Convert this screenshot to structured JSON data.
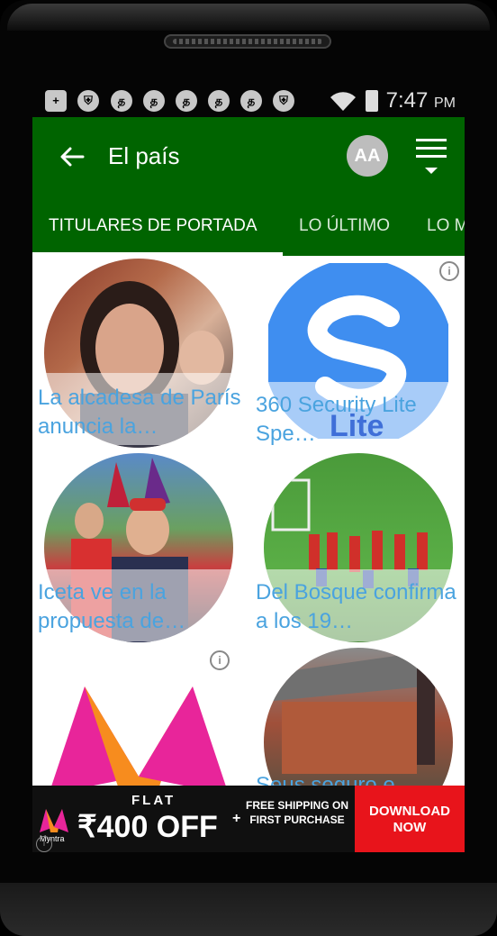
{
  "statusbar": {
    "icons": [
      "plus-box-icon",
      "shield-icon",
      "tamil-letter-icon",
      "tamil-letter-icon",
      "tamil-letter-icon",
      "tamil-letter-icon",
      "tamil-letter-icon",
      "shield-icon"
    ],
    "time": "7:47",
    "ampm": "PM"
  },
  "appbar": {
    "title": "El país",
    "font_button": "AA",
    "background": "#006400"
  },
  "tabs": [
    {
      "label": "TITULARES DE PORTADA",
      "active": true
    },
    {
      "label": "LO ÚLTIMO",
      "active": false
    },
    {
      "label": "LO M",
      "active": false
    }
  ],
  "cards": [
    {
      "caption": "La alcadesa de París anuncia la…",
      "type": "article"
    },
    {
      "caption": "360 Security Lite Spe…",
      "type": "ad",
      "logo_text": "Lite"
    },
    {
      "caption": "Iceta ve en la propuesta de…",
      "type": "article"
    },
    {
      "caption": "Del Bosque confirma a los 19…",
      "type": "article"
    },
    {
      "caption": "",
      "type": "ad"
    },
    {
      "caption": "Seus seguro e",
      "type": "article"
    }
  ],
  "banner": {
    "brand": "Myntra",
    "flat": "FLAT",
    "offer": "₹400 OFF",
    "plus": "+",
    "shipping": "FREE SHIPPING ON FIRST PURCHASE",
    "cta": "DOWNLOAD NOW"
  },
  "colors": {
    "accent": "#006400",
    "caption": "#4aa3df",
    "cta": "#e8141b"
  }
}
